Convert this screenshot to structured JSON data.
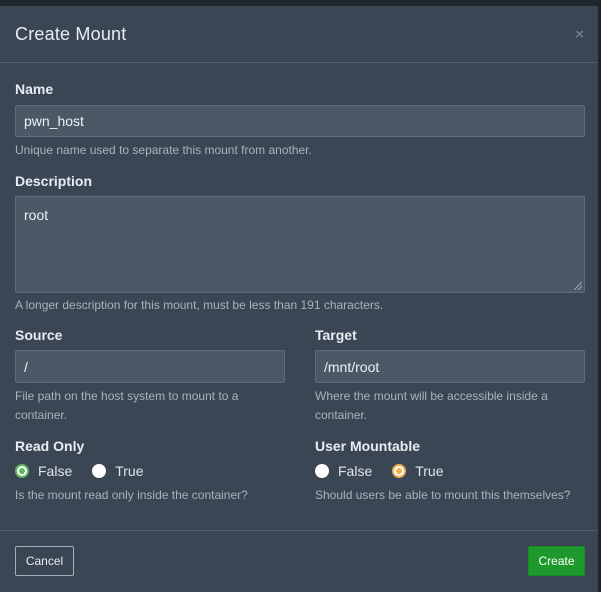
{
  "modal": {
    "title": "Create Mount",
    "close_glyph": "×"
  },
  "fields": {
    "name": {
      "label": "Name",
      "value": "pwn_host",
      "help": "Unique name used to separate this mount from another."
    },
    "description": {
      "label": "Description",
      "value": "root",
      "help": "A longer description for this mount, must be less than 191 characters."
    },
    "source": {
      "label": "Source",
      "value": "/",
      "help": "File path on the host system to mount to a container."
    },
    "target": {
      "label": "Target",
      "value": "/mnt/root",
      "help": "Where the mount will be accessible inside a container."
    },
    "read_only": {
      "label": "Read Only",
      "options": [
        "False",
        "True"
      ],
      "selected": "False",
      "help": "Is the mount read only inside the container?"
    },
    "user_mountable": {
      "label": "User Mountable",
      "options": [
        "False",
        "True"
      ],
      "selected": "True",
      "help": "Should users be able to mount this themselves?"
    }
  },
  "footer": {
    "cancel_label": "Cancel",
    "create_label": "Create"
  },
  "colors": {
    "background": "#3b4654",
    "input": "#4b5866",
    "primary": "#1e9a2c",
    "radio_selected_read_only": "#5cb85c",
    "radio_selected_user_mountable": "#f0ad4e"
  }
}
